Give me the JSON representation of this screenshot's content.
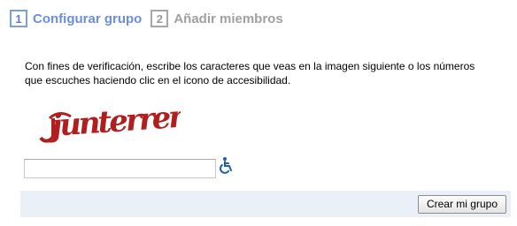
{
  "steps": [
    {
      "number": "1",
      "label": "Configurar grupo"
    },
    {
      "number": "2",
      "label": "Añadir miembros"
    }
  ],
  "instructions": "Con fines de verificación, escribe los caracteres que veas en la imagen siguiente o los números que escuches haciendo clic en el icono de accesibilidad.",
  "captcha": {
    "text": "junterren",
    "color": "#b01e1e"
  },
  "captcha_input": {
    "value": "",
    "placeholder": ""
  },
  "accessibility_icon": "wheelchair-icon",
  "colors": {
    "active_step": "#6b8fd6",
    "inactive_step": "#a0a0a0",
    "bottom_bar": "#eaf0f8",
    "accessibility_icon": "#1f5fa8"
  },
  "buttons": {
    "create_label": "Crear mi grupo"
  }
}
